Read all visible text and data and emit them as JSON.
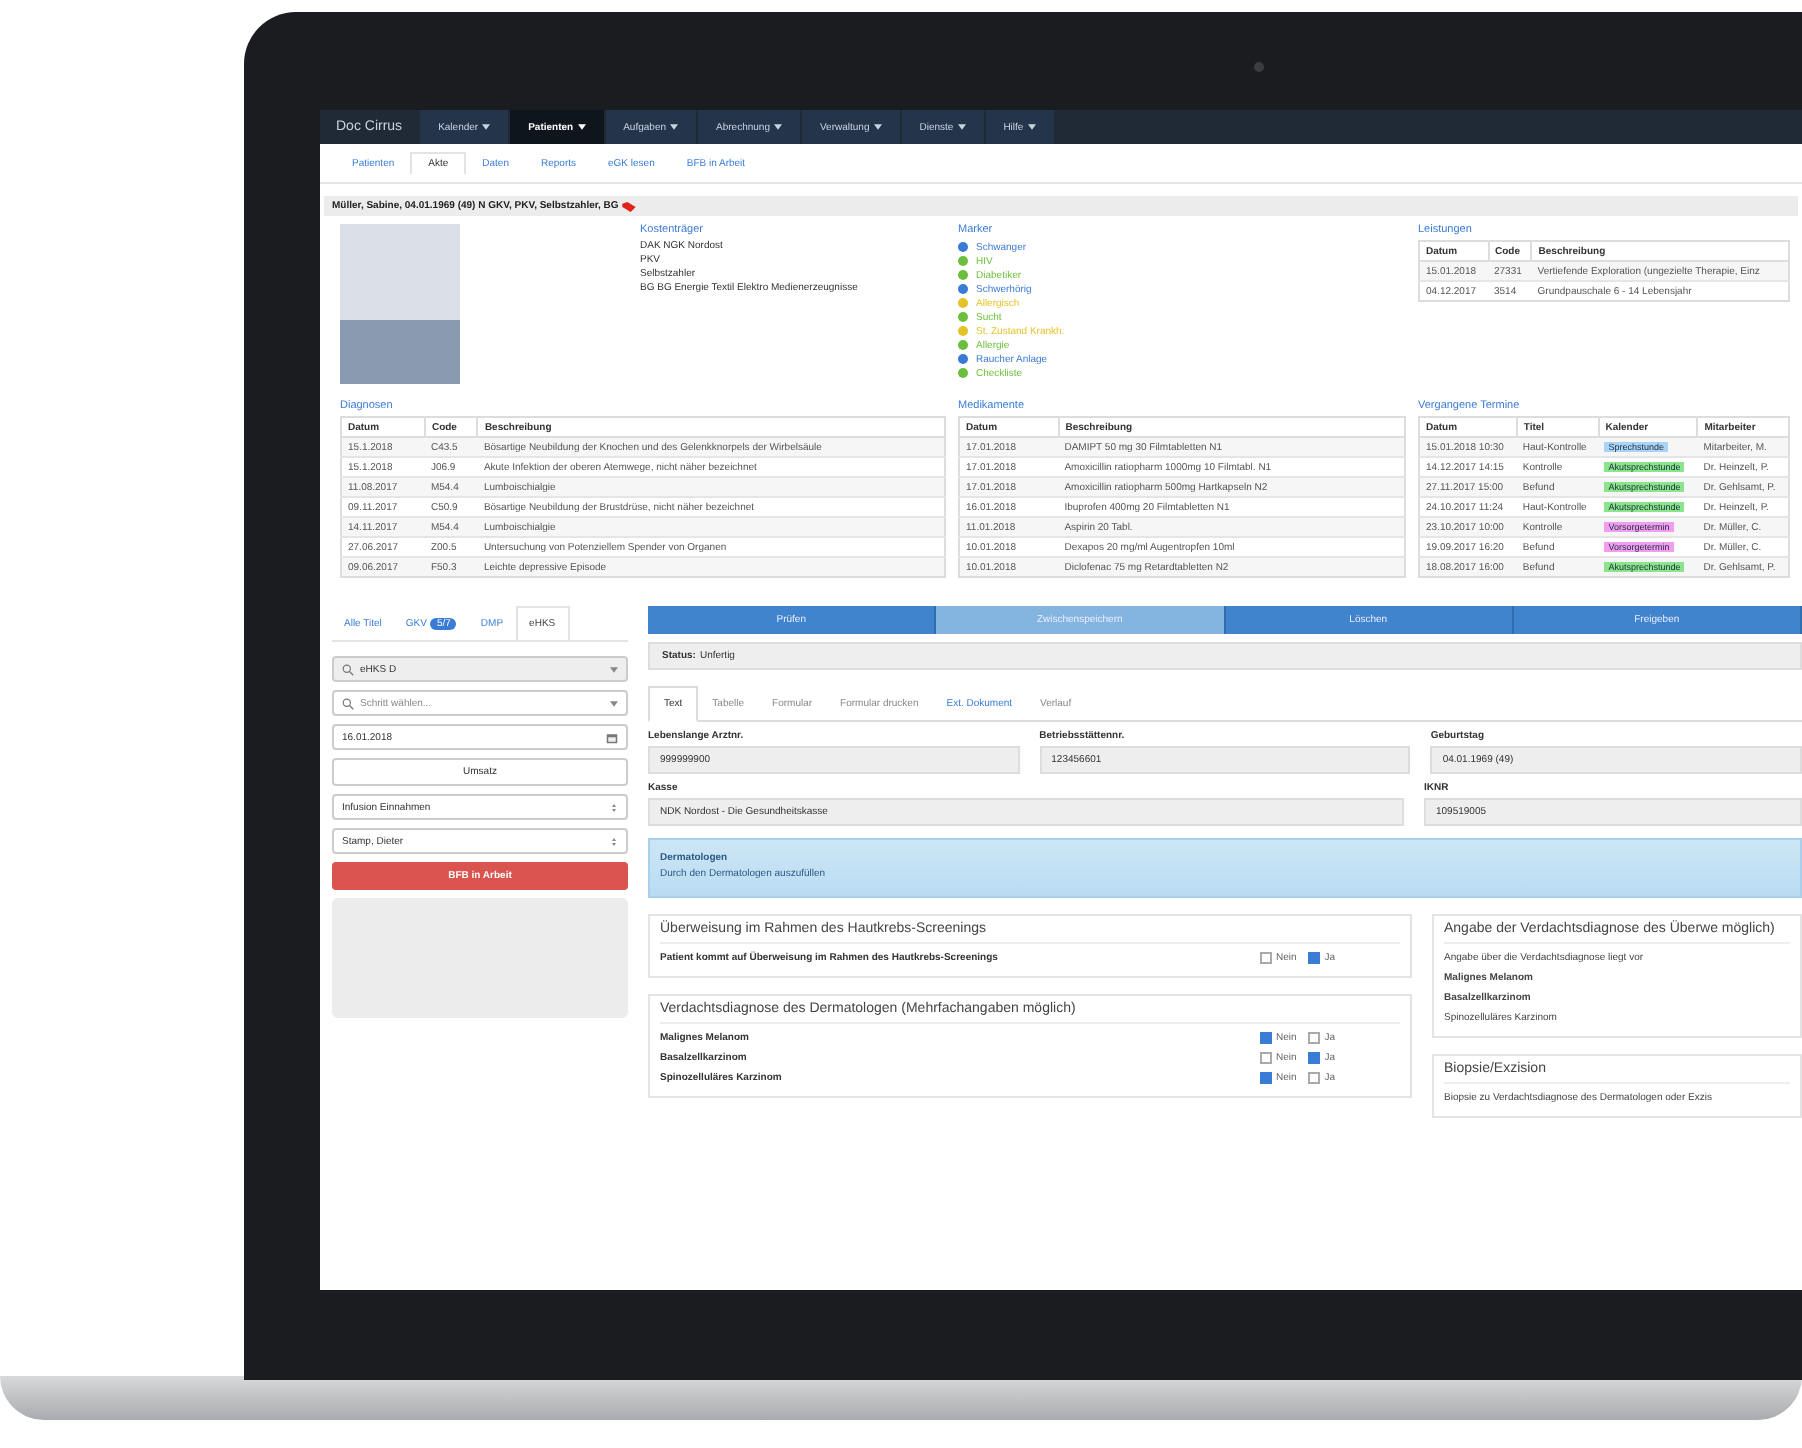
{
  "app": {
    "brand": "Doc Cirrus",
    "menu": [
      {
        "label": "Kalender",
        "selected": false
      },
      {
        "label": "Patienten",
        "selected": true
      },
      {
        "label": "Aufgaben",
        "selected": false
      },
      {
        "label": "Abrechnung",
        "selected": false
      },
      {
        "label": "Verwaltung",
        "selected": false
      },
      {
        "label": "Dienste",
        "selected": false
      },
      {
        "label": "Hilfe",
        "selected": false
      }
    ]
  },
  "subnav": [
    {
      "label": "Patienten",
      "selected": false
    },
    {
      "label": "Akte",
      "selected": true
    },
    {
      "label": "Daten",
      "selected": false
    },
    {
      "label": "Reports",
      "selected": false
    },
    {
      "label": "eGK lesen",
      "selected": false
    },
    {
      "label": "BFB in Arbeit",
      "selected": false
    }
  ],
  "patient_header": "Müller, Sabine, 04.01.1969 (49) N GKV, PKV, Selbstzahler, BG",
  "kostentraeger": {
    "title": "Kostenträger",
    "lines": [
      "DAK NGK Nordost",
      "PKV",
      "Selbstzahler",
      "BG BG Energie Textil Elektro Medienerzeugnisse"
    ]
  },
  "marker": {
    "title": "Marker",
    "items": [
      {
        "label": "Schwanger",
        "color": "#3a7bd5"
      },
      {
        "label": "HIV",
        "color": "#6cbf3c"
      },
      {
        "label": "Diabetiker",
        "color": "#6cbf3c"
      },
      {
        "label": "Schwerhörig",
        "color": "#3a7bd5"
      },
      {
        "label": "Allergisch",
        "color": "#e6c229"
      },
      {
        "label": "Sucht",
        "color": "#6cbf3c"
      },
      {
        "label": "St. Zustand Krankh.",
        "color": "#e6c229"
      },
      {
        "label": "Allergie",
        "color": "#6cbf3c"
      },
      {
        "label": "Raucher Anlage",
        "color": "#3a7bd5"
      },
      {
        "label": "Checkliste",
        "color": "#6cbf3c"
      }
    ]
  },
  "leistungen": {
    "title": "Leistungen",
    "columns": [
      "Datum",
      "Code",
      "Beschreibung"
    ],
    "rows": [
      [
        "15.01.2018",
        "27331",
        "Vertiefende Exploration (ungezielte Therapie, Einz"
      ],
      [
        "04.12.2017",
        "3514",
        "Grundpauschale 6 - 14 Lebensjahr"
      ]
    ]
  },
  "diagnosen": {
    "title": "Diagnosen",
    "columns": [
      "Datum",
      "Code",
      "Beschreibung"
    ],
    "rows": [
      [
        "15.1.2018",
        "C43.5",
        "Bösartige Neubildung der Knochen und des Gelenkknorpels der Wirbelsäule"
      ],
      [
        "15.1.2018",
        "J06.9",
        "Akute Infektion der oberen Atemwege, nicht näher bezeichnet"
      ],
      [
        "11.08.2017",
        "M54.4",
        "Lumboischialgie"
      ],
      [
        "09.11.2017",
        "C50.9",
        "Bösartige Neubildung der Brustdrüse, nicht näher bezeichnet"
      ],
      [
        "14.11.2017",
        "M54.4",
        "Lumboischialgie"
      ],
      [
        "27.06.2017",
        "Z00.5",
        "Untersuchung von Potenziellem Spender von Organen"
      ],
      [
        "09.06.2017",
        "F50.3",
        "Leichte depressive Episode"
      ]
    ]
  },
  "medikamente": {
    "title": "Medikamente",
    "columns": [
      "Datum",
      "Beschreibung"
    ],
    "rows": [
      [
        "17.01.2018",
        "DAMIPT 50 mg 30 Filmtabletten N1"
      ],
      [
        "17.01.2018",
        "Amoxicillin ratiopharm 1000mg 10 Filmtabl. N1"
      ],
      [
        "17.01.2018",
        "Amoxicillin ratiopharm 500mg Hartkapseln N2"
      ],
      [
        "16.01.2018",
        "Ibuprofen 400mg 20 Filmtabletten N1"
      ],
      [
        "11.01.2018",
        "Aspirin 20 Tabl."
      ],
      [
        "10.01.2018",
        "Dexapos 20 mg/ml Augentropfen 10ml"
      ],
      [
        "10.01.2018",
        "Diclofenac 75 mg Retardtabletten N2"
      ]
    ]
  },
  "termine": {
    "title": "Vergangene Termine",
    "columns": [
      "Datum",
      "Titel",
      "Kalender",
      "Mitarbeiter"
    ],
    "rows": [
      {
        "datum": "15.01.2018 10:30",
        "titel": "Haut-Kontrolle",
        "kalender": "Sprechstunde",
        "color": "#a9d4f5",
        "mitarbeiter": "Mitarbeiter, M."
      },
      {
        "datum": "14.12.2017 14:15",
        "titel": "Kontrolle",
        "kalender": "Akutsprechstunde",
        "color": "#8be58b",
        "mitarbeiter": "Dr. Heinzelt, P."
      },
      {
        "datum": "27.11.2017 15:00",
        "titel": "Befund",
        "kalender": "Akutsprechstunde",
        "color": "#8be58b",
        "mitarbeiter": "Dr. Gehlsamt, P."
      },
      {
        "datum": "24.10.2017 11:24",
        "titel": "Haut-Kontrolle",
        "kalender": "Akutsprechstunde",
        "color": "#8be58b",
        "mitarbeiter": "Dr. Heinzelt, P."
      },
      {
        "datum": "23.10.2017 10:00",
        "titel": "Kontrolle",
        "kalender": "Vorsorgetermin",
        "color": "#f29ef0",
        "mitarbeiter": "Dr. Müller, C."
      },
      {
        "datum": "19.09.2017 16:20",
        "titel": "Befund",
        "kalender": "Vorsorgetermin",
        "color": "#f29ef0",
        "mitarbeiter": "Dr. Müller, C."
      },
      {
        "datum": "18.08.2017 16:00",
        "titel": "Befund",
        "kalender": "Akutsprechstunde",
        "color": "#8be58b",
        "mitarbeiter": "Dr. Gehlsamt, P."
      }
    ]
  },
  "left_panel": {
    "tabs": [
      {
        "label": "Alle Titel",
        "selected": false
      },
      {
        "label": "GKV",
        "badge": "5/7",
        "selected": false
      },
      {
        "label": "DMP",
        "selected": false
      },
      {
        "label": "eHKS",
        "selected": true
      }
    ],
    "search": "eHKS D",
    "step_placeholder": "Schritt wählen...",
    "date": "16.01.2018",
    "button": "Umsatz",
    "selects": [
      "Infusion Einnahmen",
      "Stamp, Dieter"
    ],
    "action": "BFB in Arbeit"
  },
  "form": {
    "buttons": [
      {
        "label": "Prüfen",
        "selected": false
      },
      {
        "label": "Zwischenspeichern",
        "selected": true
      },
      {
        "label": "Löschen",
        "selected": false
      },
      {
        "label": "Freigeben",
        "selected": false
      }
    ],
    "status_label": "Status:",
    "status": "Unfertig",
    "tabs": [
      {
        "label": "Text",
        "selected": true,
        "kind": "tab"
      },
      {
        "label": "Tabelle",
        "selected": false,
        "kind": "tab"
      },
      {
        "label": "Formular",
        "selected": false,
        "kind": "tab"
      },
      {
        "label": "Formular drucken",
        "selected": false,
        "kind": "tab"
      },
      {
        "label": "Ext. Dokument",
        "selected": false,
        "kind": "link"
      },
      {
        "label": "Verlauf",
        "selected": false,
        "kind": "tab"
      }
    ],
    "field_rows": [
      [
        {
          "label": "Lebenslange Arztnr.",
          "value": "999999900"
        },
        {
          "label": "Betriebsstättennr.",
          "value": "123456601"
        },
        {
          "label": "Geburtstag",
          "value": "04.01.1969 (49)"
        }
      ],
      [
        {
          "label": "Kasse",
          "value": "NDK Nordost - Die Gesundheitskasse"
        },
        {
          "label": "IKNR",
          "value": "109519005"
        }
      ]
    ],
    "notice": {
      "title": "Dermatologen",
      "text": "Durch den Dermatologen auszufüllen"
    },
    "left_sections": [
      {
        "title": "Überweisung im Rahmen des Hautkrebs-Screenings",
        "rows": [
          {
            "label": "Patient kommt auf Überweisung im Rahmen des Hautkrebs-Screenings",
            "options": [
              {
                "label": "Nein",
                "checked": false
              },
              {
                "label": "Ja",
                "checked": true
              }
            ]
          }
        ]
      },
      {
        "title": "Verdachtsdiagnose des Dermatologen (Mehrfachangaben möglich)",
        "rows": [
          {
            "label": "Malignes Melanom",
            "options": [
              {
                "label": "Nein",
                "checked": true
              },
              {
                "label": "Ja",
                "checked": false
              }
            ]
          },
          {
            "label": "Basalzellkarzinom",
            "options": [
              {
                "label": "Nein",
                "checked": false
              },
              {
                "label": "Ja",
                "checked": true
              }
            ]
          },
          {
            "label": "Spinozelluläres Karzinom",
            "options": [
              {
                "label": "Nein",
                "checked": true
              },
              {
                "label": "Ja",
                "checked": false
              }
            ]
          }
        ]
      }
    ],
    "right_sections": [
      {
        "title": "Angabe der Verdachtsdiagnose des Überwe möglich)",
        "lines": [
          {
            "text": "Angabe über die Verdachtsdiagnose liegt vor",
            "bold": false
          },
          {
            "text": "Malignes Melanom",
            "bold": true
          },
          {
            "text": "Basalzellkarzinom",
            "bold": true
          },
          {
            "text": "Spinozelluläres Karzinom",
            "bold": false
          }
        ]
      },
      {
        "title": "Biopsie/Exzision",
        "lines": [
          {
            "text": "Biopsie zu Verdachtsdiagnose des Dermatologen oder Exzis",
            "bold": false
          }
        ]
      }
    ]
  }
}
